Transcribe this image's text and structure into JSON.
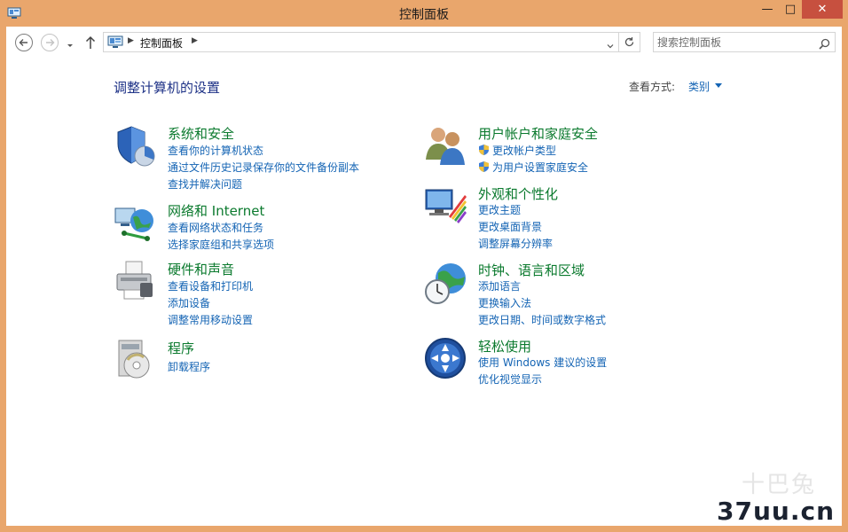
{
  "window": {
    "title": "控制面板"
  },
  "controls": {
    "minimize": "—",
    "maximize": "□",
    "close": "✕"
  },
  "address": {
    "crumb": "控制面板"
  },
  "search": {
    "placeholder": "搜索控制面板"
  },
  "header": {
    "title": "调整计算机的设置",
    "view_label": "查看方式:",
    "view_value": "类别"
  },
  "categories": [
    {
      "icon": "shield-security-icon",
      "title": "系统和安全",
      "links": [
        "查看你的计算机状态",
        "通过文件历史记录保存你的文件备份副本",
        "查找并解决问题"
      ]
    },
    {
      "icon": "network-globe-icon",
      "title": "网络和 Internet",
      "links": [
        "查看网络状态和任务",
        "选择家庭组和共享选项"
      ]
    },
    {
      "icon": "printer-hardware-icon",
      "title": "硬件和声音",
      "links": [
        "查看设备和打印机",
        "添加设备",
        "调整常用移动设置"
      ]
    },
    {
      "icon": "programs-box-icon",
      "title": "程序",
      "links": [
        "卸载程序"
      ]
    },
    {
      "icon": "users-icon",
      "title": "用户帐户和家庭安全",
      "links": [
        "更改帐户类型",
        "为用户设置家庭安全"
      ]
    },
    {
      "icon": "appearance-monitor-icon",
      "title": "外观和个性化",
      "links": [
        "更改主题",
        "更改桌面背景",
        "调整屏幕分辨率"
      ]
    },
    {
      "icon": "clock-globe-icon",
      "title": "时钟、语言和区域",
      "links": [
        "添加语言",
        "更换输入法",
        "更改日期、时间或数字格式"
      ]
    },
    {
      "icon": "ease-of-access-icon",
      "title": "轻松使用",
      "links": [
        "使用 Windows 建议的设置",
        "优化视觉显示"
      ]
    }
  ],
  "watermark": {
    "text": "37uu.cn"
  },
  "colors": {
    "title_bar": "#e9a66c",
    "category_heading": "#0b7a2e",
    "link": "#1464b4",
    "page_title": "#1e3287",
    "close_button": "#c7503f"
  }
}
